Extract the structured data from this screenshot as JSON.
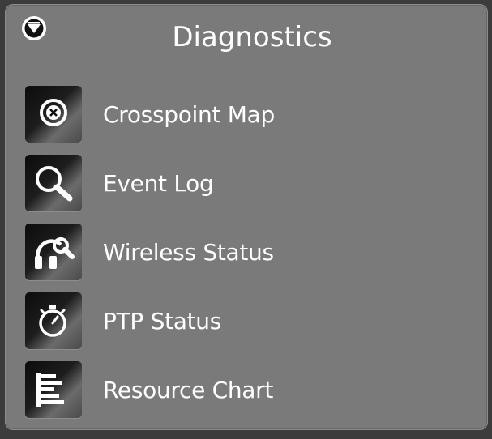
{
  "panel": {
    "title": "Diagnostics",
    "collapse_icon": "chevron-down-circle-icon"
  },
  "menu": {
    "items": [
      {
        "label": "Crosspoint Map",
        "icon": "crosspoint-map-icon"
      },
      {
        "label": "Event Log",
        "icon": "magnifier-icon"
      },
      {
        "label": "Wireless Status",
        "icon": "wireless-headset-icon"
      },
      {
        "label": "PTP Status",
        "icon": "stopwatch-icon"
      },
      {
        "label": "Resource Chart",
        "icon": "bar-chart-icon"
      }
    ]
  },
  "colors": {
    "panel_bg": "#7a7a7a",
    "text": "#ffffff",
    "icon_bg": "#0c0c0c"
  }
}
